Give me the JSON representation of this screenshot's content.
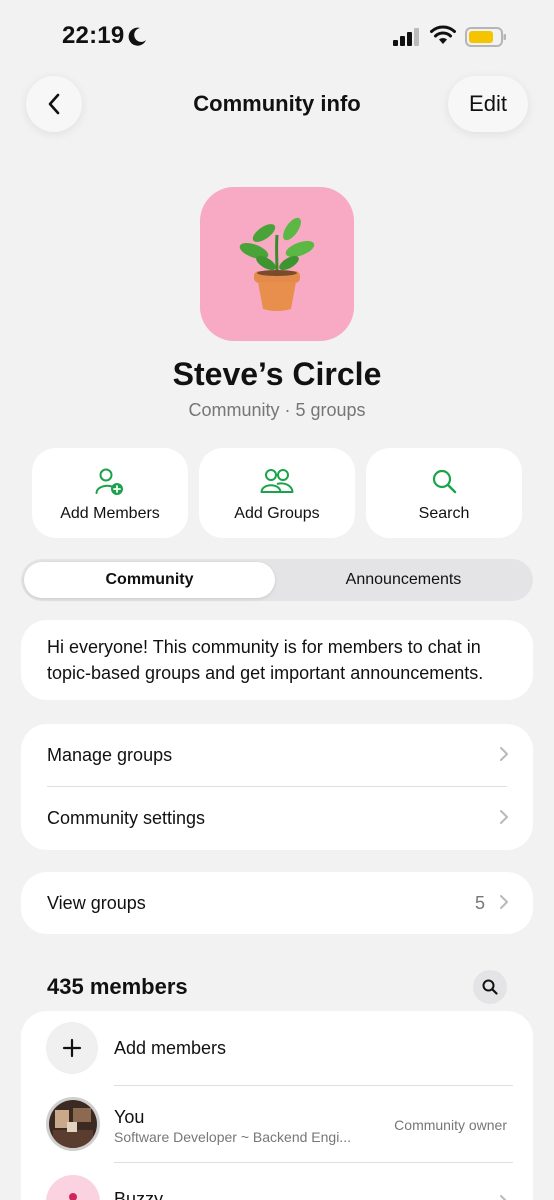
{
  "status_bar": {
    "time": "22:19"
  },
  "header": {
    "title": "Community info",
    "edit_label": "Edit"
  },
  "community": {
    "name": "Steve’s Circle",
    "subtitle": "Community · 5 groups",
    "avatar_color": "#f8a9c4"
  },
  "actions": [
    {
      "label": "Add Members",
      "icon": "add-member-icon"
    },
    {
      "label": "Add Groups",
      "icon": "groups-icon"
    },
    {
      "label": "Search",
      "icon": "search-icon"
    }
  ],
  "tabs": {
    "active": "Community",
    "inactive": "Announcements"
  },
  "description": "Hi everyone! This community is for members to chat in topic-based groups and get important announcements.",
  "settings": {
    "manage_groups": "Manage groups",
    "community_settings": "Community settings"
  },
  "view_groups": {
    "label": "View groups",
    "count": "5"
  },
  "members": {
    "title": "435 members",
    "add_label": "Add members",
    "list": [
      {
        "name": "You",
        "about": "Software Developer ~ Backend Engi...",
        "role": "Community owner"
      },
      {
        "name": "Buzzy"
      }
    ]
  },
  "colors": {
    "accent": "#1aa34a",
    "background": "#f2f2f2"
  }
}
